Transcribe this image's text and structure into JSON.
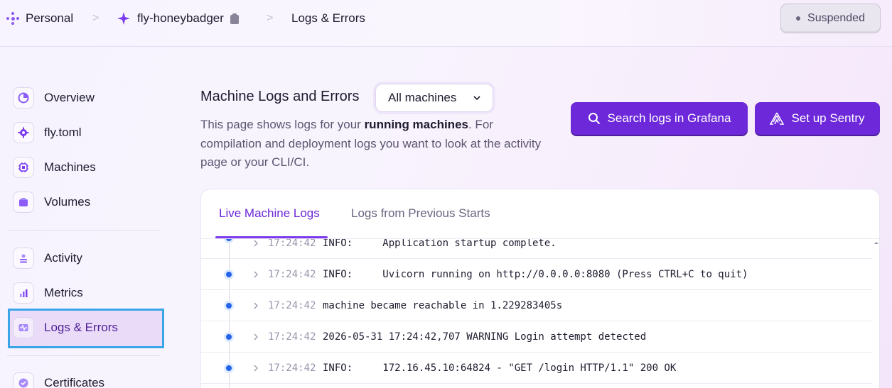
{
  "breadcrumb": {
    "org": "Personal",
    "app": "fly-honeybadger",
    "page": "Logs & Errors",
    "separator": ">"
  },
  "status": {
    "label": "Suspended"
  },
  "sidebar": {
    "items": [
      {
        "label": "Overview",
        "icon": "pie-chart-icon"
      },
      {
        "label": "fly.toml",
        "icon": "gear-icon"
      },
      {
        "label": "Machines",
        "icon": "cpu-icon"
      },
      {
        "label": "Volumes",
        "icon": "volume-icon"
      },
      {
        "label": "Activity",
        "icon": "activity-icon"
      },
      {
        "label": "Metrics",
        "icon": "bar-chart-icon"
      },
      {
        "label": "Logs & Errors",
        "icon": "pulse-icon",
        "active": true
      },
      {
        "label": "Certificates",
        "icon": "check-badge-icon"
      }
    ]
  },
  "main": {
    "title": "Machine Logs and Errors",
    "machine_select": {
      "value": "All machines"
    },
    "description": {
      "part1": "This page shows logs for your ",
      "bold": "running machines",
      "part2": ". For compilation and deployment logs you want to look at the activity page or your CLI/CI."
    },
    "buttons": {
      "grafana": "Search logs in Grafana",
      "sentry": "Set up Sentry"
    }
  },
  "logs": {
    "tabs": [
      {
        "label": "Live Machine Logs",
        "active": true
      },
      {
        "label": "Logs from Previous Starts",
        "active": false
      }
    ],
    "rows": [
      {
        "time": "17:24:42",
        "message": "INFO:     Application startup complete."
      },
      {
        "time": "17:24:42",
        "message": "INFO:     Uvicorn running on http://0.0.0.0:8080 (Press CTRL+C to quit)"
      },
      {
        "time": "17:24:42",
        "message": "machine became reachable in 1.229283405s"
      },
      {
        "time": "17:24:42",
        "message": "2026-05-31 17:24:42,707 WARNING Login attempt detected"
      },
      {
        "time": "17:24:42",
        "message": "INFO:     172.16.45.10:64824 - \"GET /login HTTP/1.1\" 200 OK"
      }
    ]
  },
  "colors": {
    "accent": "#6d28d9",
    "active_highlight": "#3aa6e8",
    "log_dot": "#2563eb"
  }
}
